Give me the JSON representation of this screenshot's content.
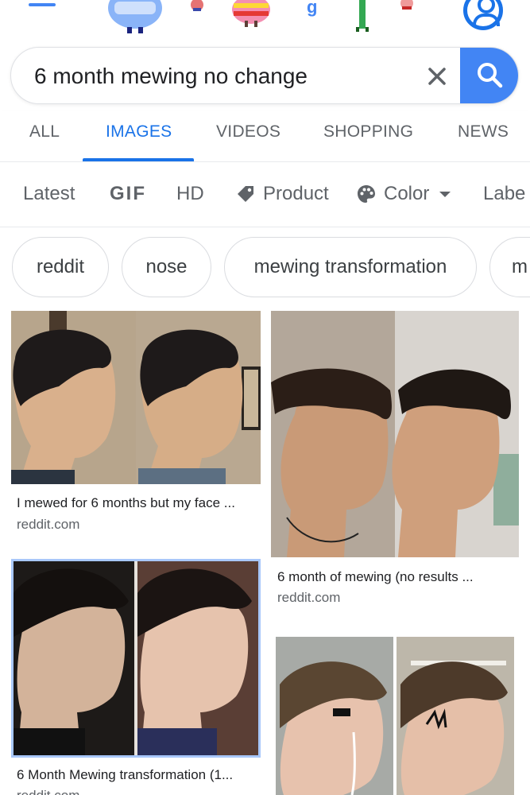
{
  "search": {
    "query": "6 month mewing no change"
  },
  "tabs": [
    {
      "label": "ALL"
    },
    {
      "label": "IMAGES"
    },
    {
      "label": "VIDEOS"
    },
    {
      "label": "SHOPPING"
    },
    {
      "label": "NEWS"
    }
  ],
  "filters": {
    "latest": "Latest",
    "gif": "GIF",
    "hd": "HD",
    "product": "Product",
    "color": "Color",
    "labeled": "Labe"
  },
  "chips": [
    {
      "label": "reddit"
    },
    {
      "label": "nose"
    },
    {
      "label": "mewing transformation"
    },
    {
      "label": "m"
    }
  ],
  "results": [
    {
      "caption": "I mewed for 6 months but my face ...",
      "source": "reddit.com"
    },
    {
      "caption": "6 month of mewing (no results ...",
      "source": "reddit.com"
    },
    {
      "caption": "6 Month Mewing transformation (1...",
      "source": "reddit.com"
    },
    {
      "caption": "",
      "source": ""
    }
  ],
  "colors": {
    "accent": "#1a73e8",
    "search_button": "#4285f4"
  },
  "icons": [
    "menu-icon",
    "account-icon",
    "clear-icon",
    "search-icon",
    "tag-icon",
    "palette-icon",
    "caret-down-icon"
  ]
}
